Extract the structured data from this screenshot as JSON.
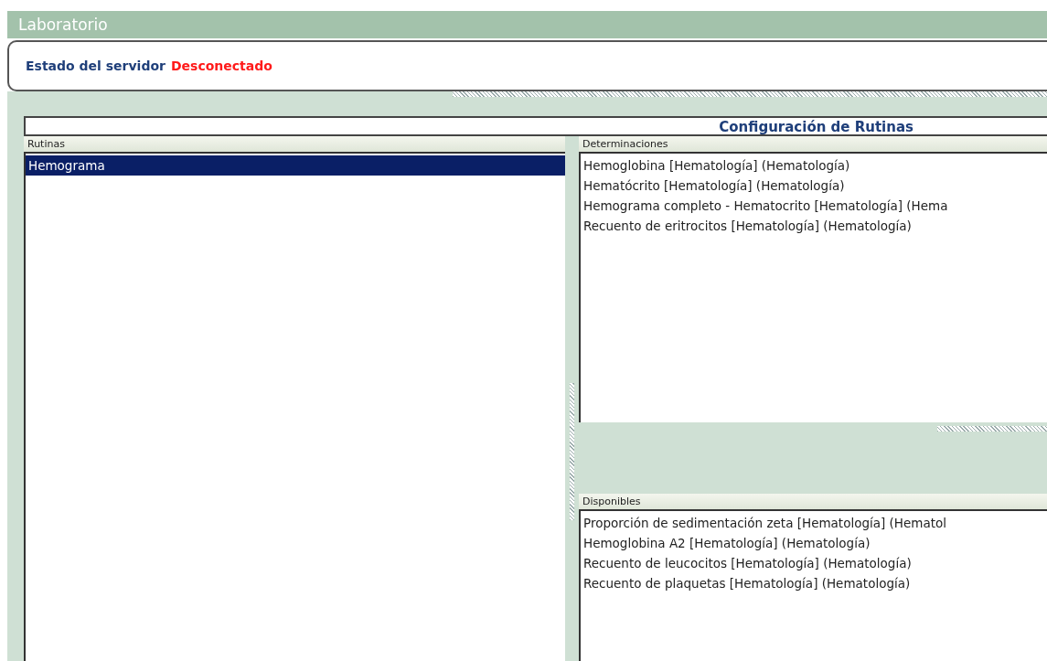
{
  "window": {
    "title": "Laboratorio"
  },
  "server_status": {
    "label": "Estado del servidor",
    "value": "Desconectado"
  },
  "section_title": "Configuración de Rutinas",
  "routines": {
    "header": "Rutinas",
    "items": [
      {
        "label": "Hemograma",
        "selected": true
      }
    ]
  },
  "determinations": {
    "header": "Determinaciones",
    "items": [
      "Hemoglobina [Hematología] (Hematología)",
      "Hematócrito [Hematología] (Hematología)",
      "Hemograma completo - Hematocrito [Hematología] (Hema",
      "Recuento de eritrocitos [Hematología] (Hematología)"
    ]
  },
  "available": {
    "header": "Disponibles",
    "items": [
      "Proporción de sedimentación zeta [Hematología] (Hematol",
      "Hemoglobina A2 [Hematología] (Hematología)",
      "Recuento de leucocitos [Hematología] (Hematología)",
      "Recuento de plaquetas [Hematología] (Hematología)"
    ]
  }
}
